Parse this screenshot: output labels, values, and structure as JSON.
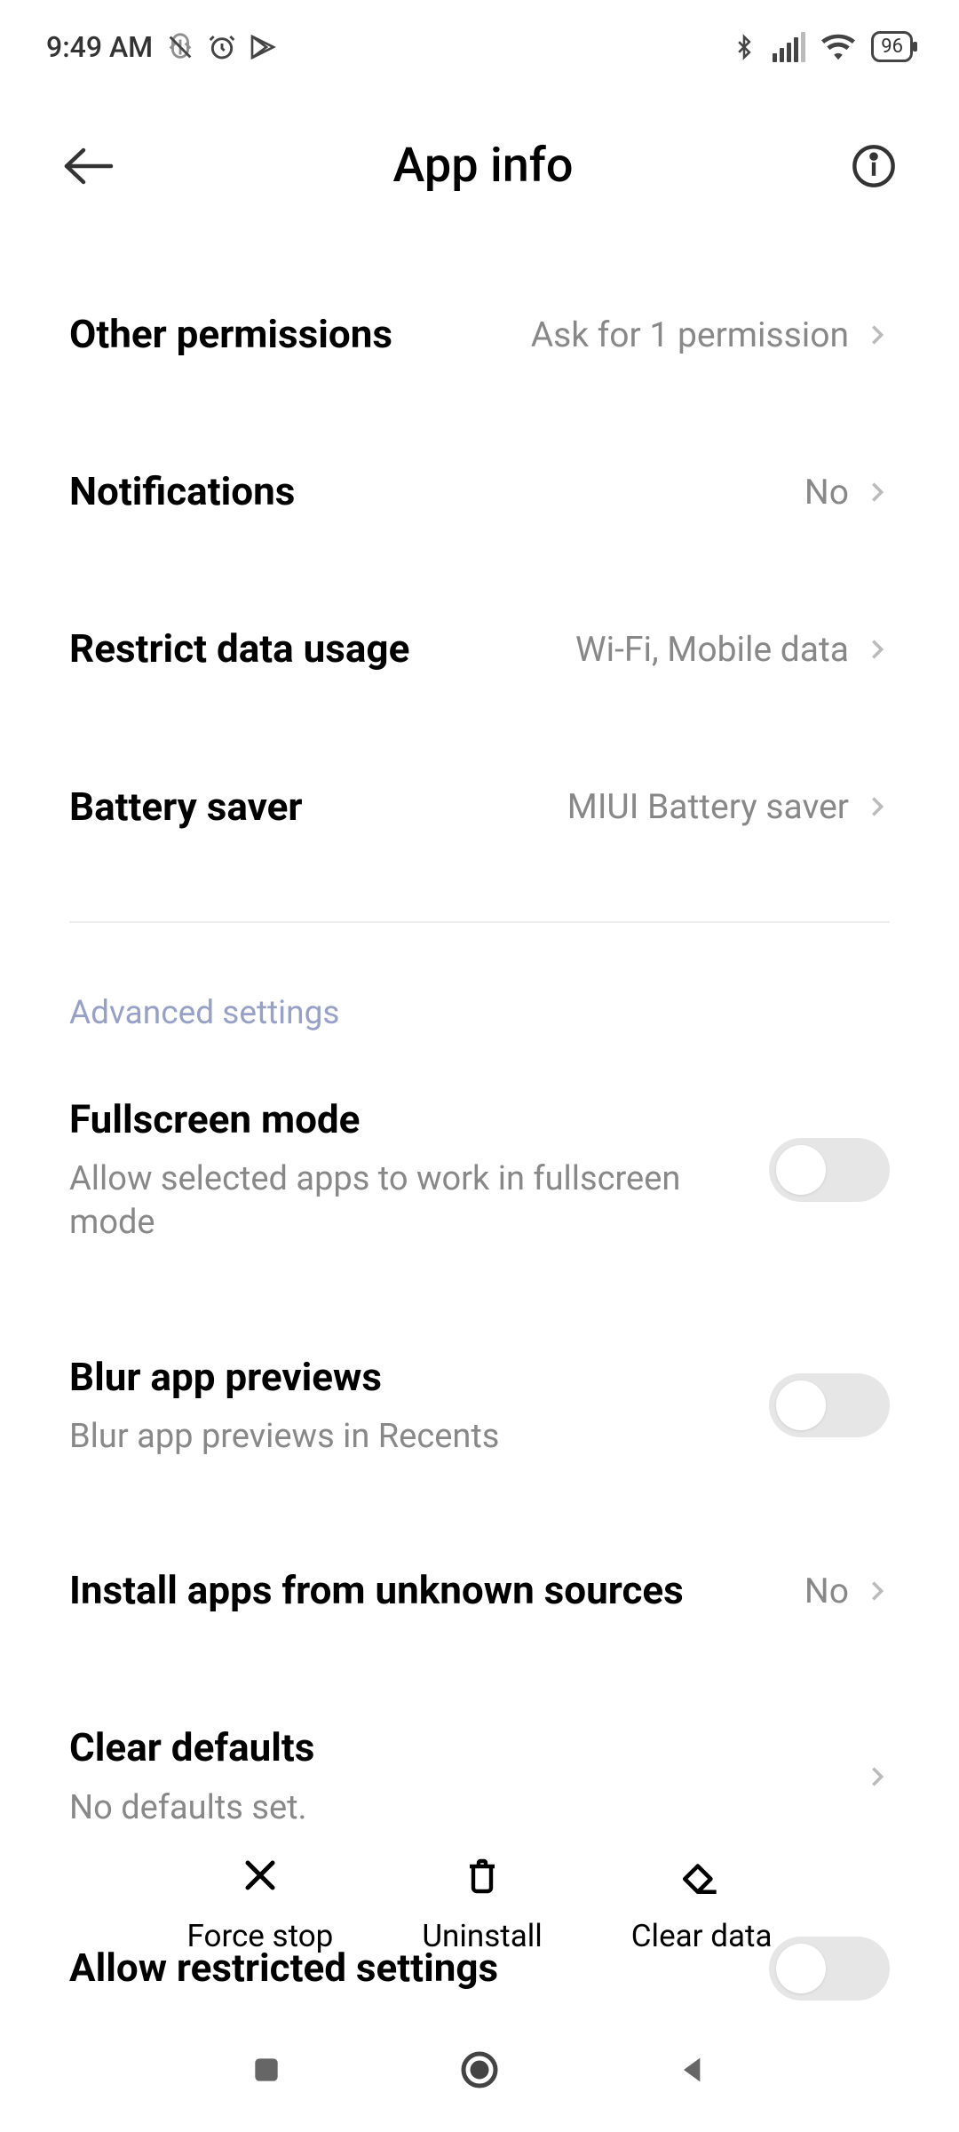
{
  "status": {
    "time": "9:49 AM",
    "battery": "96"
  },
  "header": {
    "title": "App info"
  },
  "rows": {
    "other_permissions": {
      "title": "Other permissions",
      "value": "Ask for 1 permission"
    },
    "notifications": {
      "title": "Notifications",
      "value": "No"
    },
    "restrict_data": {
      "title": "Restrict data usage",
      "value": "Wi-Fi, Mobile data"
    },
    "battery_saver": {
      "title": "Battery saver",
      "value": "MIUI Battery saver"
    },
    "section": "Advanced settings",
    "fullscreen": {
      "title": "Fullscreen mode",
      "subtitle": "Allow selected apps to work in fullscreen mode"
    },
    "blur": {
      "title": "Blur app previews",
      "subtitle": "Blur app previews in Recents"
    },
    "unknown_sources": {
      "title": "Install apps from unknown sources",
      "value": "No"
    },
    "clear_defaults": {
      "title": "Clear defaults",
      "subtitle": "No defaults set."
    },
    "restricted": {
      "title": "Allow restricted settings"
    }
  },
  "actions": {
    "force_stop": "Force stop",
    "uninstall": "Uninstall",
    "clear_data": "Clear data"
  }
}
